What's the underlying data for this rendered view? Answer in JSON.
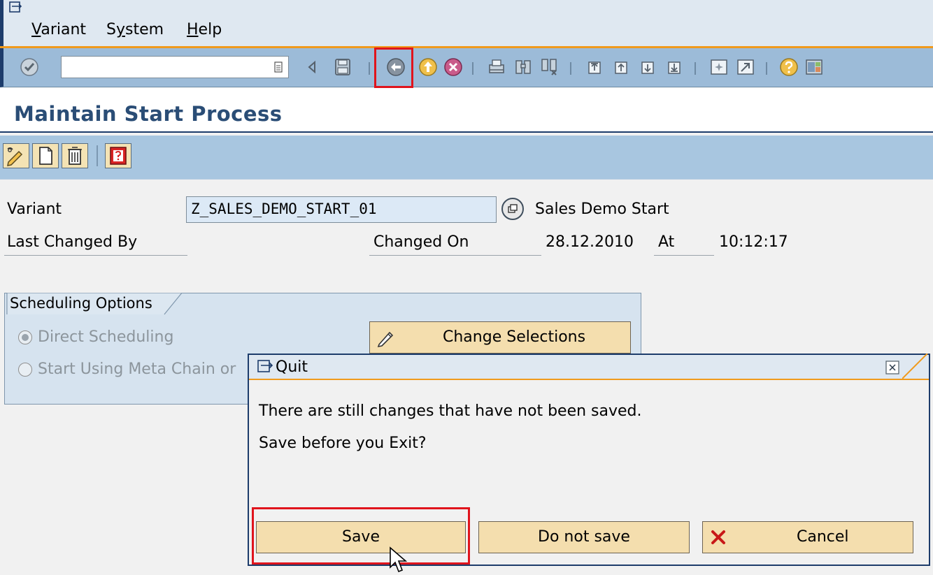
{
  "menubar": {
    "items": [
      {
        "pre": "",
        "accel": "V",
        "post": "ariant"
      },
      {
        "pre": "S",
        "accel": "y",
        "post": "stem"
      },
      {
        "pre": "",
        "accel": "H",
        "post": "elp"
      }
    ]
  },
  "toolbar": {
    "command_field_value": "",
    "icons": [
      "enter-icon",
      "dropdown-icon",
      "collapse-icon",
      "save-icon",
      "back-icon",
      "exit-icon",
      "cancel-icon",
      "print-icon",
      "find-icon",
      "find-next-icon",
      "first-page-icon",
      "previous-page-icon",
      "next-page-icon",
      "last-page-icon",
      "create-session-icon",
      "shortcut-icon",
      "help-icon",
      "customize-layout-icon"
    ]
  },
  "page": {
    "title": "Maintain Start Process"
  },
  "app_toolbar": {
    "icons": [
      "change-display-icon",
      "create-icon",
      "delete-icon",
      "where-used-icon"
    ]
  },
  "form": {
    "variant_label": "Variant",
    "variant_value": "Z_SALES_DEMO_START_01",
    "variant_description": "Sales Demo Start",
    "last_changed_by_label": "Last Changed By",
    "last_changed_by_value": "",
    "changed_on_label": "Changed On",
    "changed_on_value": "28.12.2010",
    "at_label": "At",
    "at_value": "10:12:17"
  },
  "scheduling": {
    "group_title": "Scheduling Options",
    "direct_label": "Direct Scheduling",
    "meta_chain_label": "Start Using Meta Chain or",
    "change_selections_label": "Change Selections"
  },
  "dialog": {
    "title": "Quit",
    "message_line1": "There are still changes that have not been saved.",
    "message_line2": "Save before you Exit?",
    "save_label": "Save",
    "do_not_save_label": "Do not save",
    "cancel_label": "Cancel"
  },
  "colors": {
    "highlight": "#e0141c",
    "title": "#2a4d76",
    "button_bg": "#f4deae",
    "toolbar_bg": "#9cbbd8"
  }
}
